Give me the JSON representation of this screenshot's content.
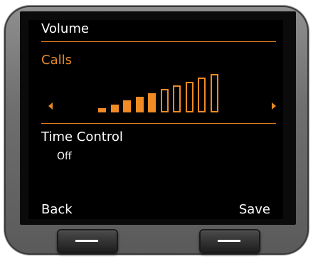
{
  "screen": {
    "title": "Volume",
    "section_label": "Calls",
    "volume": {
      "level": 5,
      "max": 10
    },
    "time_control": {
      "label": "Time Control",
      "value": "Off"
    }
  },
  "softkeys": {
    "left": "Back",
    "right": "Save"
  },
  "colors": {
    "accent": "#f08a24",
    "screen_bg": "#000000",
    "text": "#ffffff"
  },
  "icons": {
    "left_arrow": "triangle-left-icon",
    "right_arrow": "triangle-right-icon"
  }
}
